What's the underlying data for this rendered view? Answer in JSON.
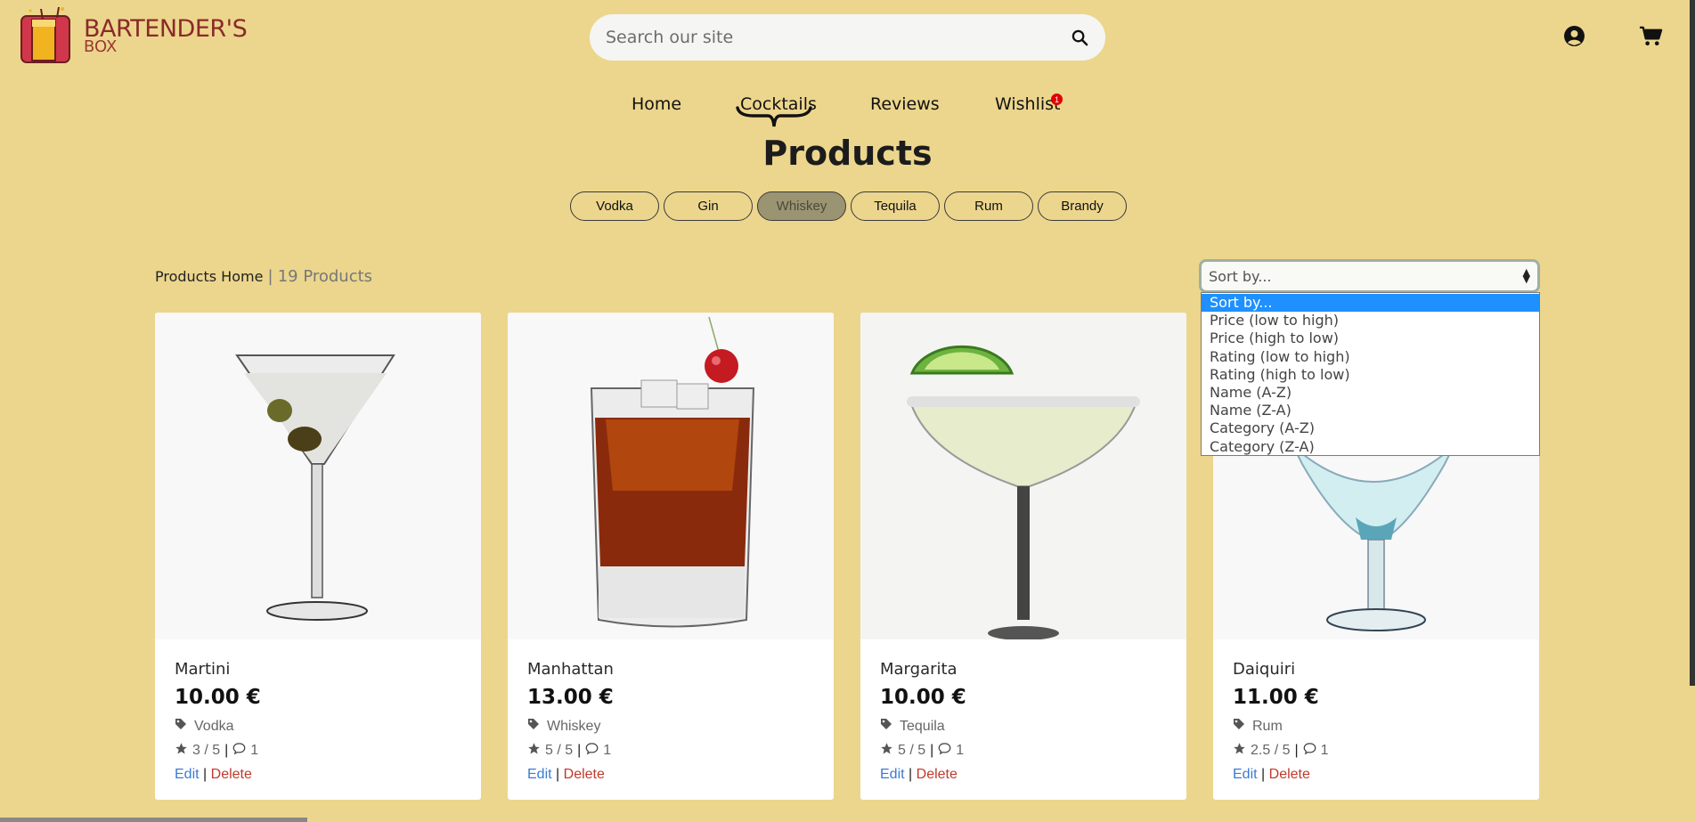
{
  "brand": {
    "title": "BARTENDER'S",
    "subtitle": "BOX"
  },
  "search": {
    "placeholder": "Search our site"
  },
  "nav": {
    "home": "Home",
    "cocktails": "Cocktails",
    "reviews": "Reviews",
    "wishlist": "Wishlist",
    "wishlist_count": "1"
  },
  "page_title": "Products",
  "filters": [
    "Vodka",
    "Gin",
    "Whiskey",
    "Tequila",
    "Rum",
    "Brandy"
  ],
  "active_filter": "Whiskey",
  "breadcrumb": {
    "home": "Products Home",
    "separator": "|",
    "count": "19 Products"
  },
  "sort": {
    "selected": "Sort by...",
    "options": [
      "Sort by...",
      "Price (low to high)",
      "Price (high to low)",
      "Rating (low to high)",
      "Rating (high to low)",
      "Name (A-Z)",
      "Name (Z-A)",
      "Category (A-Z)",
      "Category (Z-A)"
    ]
  },
  "products": [
    {
      "name": "Martini",
      "price": "10.00 €",
      "category": "Vodka",
      "rating": "3 / 5",
      "comments": "1",
      "edit": "Edit",
      "delete": "Delete"
    },
    {
      "name": "Manhattan",
      "price": "13.00 €",
      "category": "Whiskey",
      "rating": "5 / 5",
      "comments": "1",
      "edit": "Edit",
      "delete": "Delete"
    },
    {
      "name": "Margarita",
      "price": "10.00 €",
      "category": "Tequila",
      "rating": "5 / 5",
      "comments": "1",
      "edit": "Edit",
      "delete": "Delete"
    },
    {
      "name": "Daiquiri",
      "price": "11.00 €",
      "category": "Rum",
      "rating": "2.5 / 5",
      "comments": "1",
      "edit": "Edit",
      "delete": "Delete"
    }
  ],
  "colors": {
    "background": "#ecd68d",
    "active_filter": "#9b9472",
    "edit": "#3a7bd5",
    "delete": "#c0392b",
    "badge": "#e00000",
    "selected_option": "#1e90ff"
  }
}
